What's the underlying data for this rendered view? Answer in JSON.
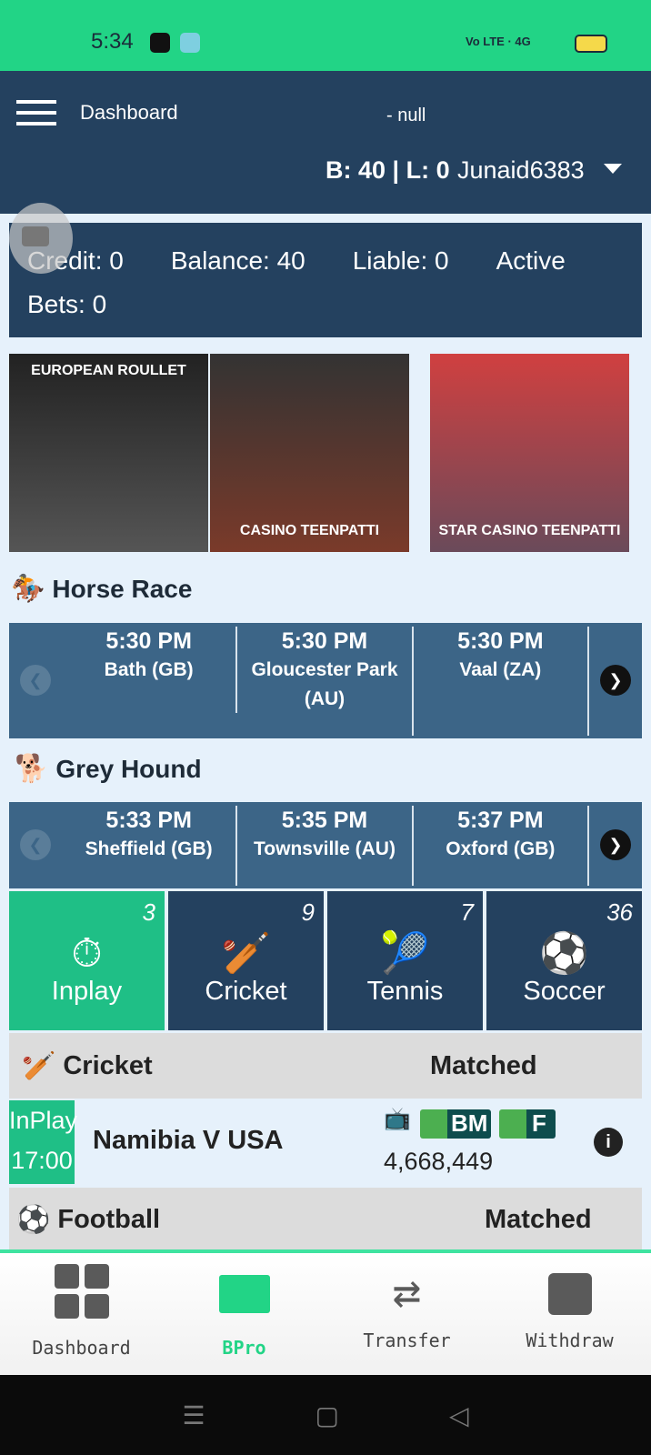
{
  "status_bar": {
    "time": "5:34",
    "network": "Vo LTE · 4G"
  },
  "header": {
    "title": "Dashboard",
    "subtitle": "- null",
    "summary": "B: 40 | L: 0",
    "username": "Junaid6383"
  },
  "account": {
    "credit": "Credit: 0",
    "balance": "Balance: 40",
    "liable": "Liable: 0",
    "active_bets": "Active Bets: 0"
  },
  "casino": [
    {
      "label": "EUROPEAN ROULLET",
      "color": "#3a3a3a"
    },
    {
      "label": "CASINO TEENPATTI",
      "color": "#5a2a2a"
    },
    {
      "label": "STAR CASINO TEENPATTI",
      "color": "#b33030"
    }
  ],
  "horse_race": {
    "title": "Horse Race",
    "races": [
      {
        "time": "5:30 PM",
        "venue": "Bath (GB)"
      },
      {
        "time": "5:30 PM",
        "venue": "Gloucester Park (AU)"
      },
      {
        "time": "5:30 PM",
        "venue": "Vaal (ZA)"
      }
    ]
  },
  "grey_hound": {
    "title": "Grey Hound",
    "races": [
      {
        "time": "5:33 PM",
        "venue": "Sheffield (GB)"
      },
      {
        "time": "5:35 PM",
        "venue": "Townsville (AU)"
      },
      {
        "time": "5:37 PM",
        "venue": "Oxford (GB)"
      }
    ]
  },
  "sports": [
    {
      "label": "Inplay",
      "count": "3",
      "icon": "stopwatch-icon"
    },
    {
      "label": "Cricket",
      "count": "9",
      "icon": "cricket-icon"
    },
    {
      "label": "Tennis",
      "count": "7",
      "icon": "tennis-icon"
    },
    {
      "label": "Soccer",
      "count": "36",
      "icon": "soccer-icon"
    }
  ],
  "cricket": {
    "title": "Cricket",
    "col": "Matched",
    "match": {
      "status": "InPlay",
      "time": "17:00",
      "name": "Namibia V USA",
      "badge1": "BM",
      "badge2": "F",
      "matched": "4,668,449"
    }
  },
  "football": {
    "title": "Football",
    "col": "Matched"
  },
  "nav": [
    {
      "label": "Dashboard"
    },
    {
      "label": "BPro"
    },
    {
      "label": "Transfer"
    },
    {
      "label": "Withdraw"
    }
  ],
  "colors": {
    "accent": "#1fbf86",
    "navy": "#24415f",
    "race": "#3c6587"
  }
}
